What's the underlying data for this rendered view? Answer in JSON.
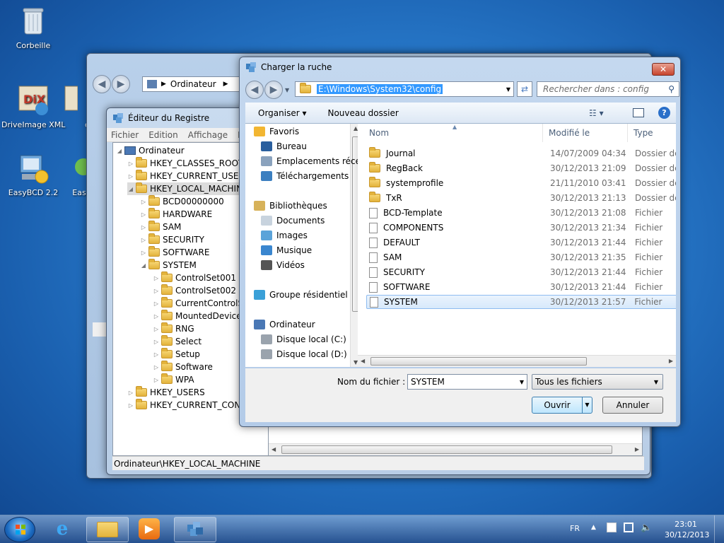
{
  "desktop": {
    "icons": [
      {
        "label": "Corbeille"
      },
      {
        "label": "DriveImage XML"
      },
      {
        "label": "di"
      },
      {
        "label": "EasyBCD 2.2"
      },
      {
        "label": "Eas"
      }
    ]
  },
  "explorer_back": {
    "address": "Ordinateur"
  },
  "regedit": {
    "title": "Éditeur du Registre",
    "menu": [
      "Fichier",
      "Edition",
      "Affichage",
      "Fa"
    ],
    "tree": [
      {
        "label": "Ordinateur",
        "level": 0,
        "expanded": true
      },
      {
        "label": "HKEY_CLASSES_ROOT",
        "level": 1
      },
      {
        "label": "HKEY_CURRENT_USER",
        "level": 1
      },
      {
        "label": "HKEY_LOCAL_MACHINE",
        "level": 1,
        "expanded": true,
        "selected": true
      },
      {
        "label": "BCD00000000",
        "level": 2
      },
      {
        "label": "HARDWARE",
        "level": 2
      },
      {
        "label": "SAM",
        "level": 2
      },
      {
        "label": "SECURITY",
        "level": 2
      },
      {
        "label": "SOFTWARE",
        "level": 2
      },
      {
        "label": "SYSTEM",
        "level": 2,
        "expanded": true
      },
      {
        "label": "ControlSet001",
        "level": 3
      },
      {
        "label": "ControlSet002",
        "level": 3
      },
      {
        "label": "CurrentControlSet",
        "level": 3
      },
      {
        "label": "MountedDevices",
        "level": 3
      },
      {
        "label": "RNG",
        "level": 3
      },
      {
        "label": "Select",
        "level": 3
      },
      {
        "label": "Setup",
        "level": 3
      },
      {
        "label": "Software",
        "level": 3
      },
      {
        "label": "WPA",
        "level": 3
      },
      {
        "label": "HKEY_USERS",
        "level": 1
      },
      {
        "label": "HKEY_CURRENT_CONFIG",
        "level": 1
      }
    ],
    "status": "Ordinateur\\HKEY_LOCAL_MACHINE"
  },
  "dialog": {
    "title": "Charger la ruche",
    "close_label": "✕",
    "address": "E:\\Windows\\System32\\config",
    "search_placeholder": "Rechercher dans : config",
    "toolbar": {
      "organize": "Organiser ▾",
      "new_folder": "Nouveau dossier"
    },
    "nav": [
      {
        "label": "Favoris",
        "type": "header",
        "icon": "star-icon"
      },
      {
        "label": "Bureau",
        "icon": "desktop-icon"
      },
      {
        "label": "Emplacements récents",
        "icon": "recent-icon"
      },
      {
        "label": "Téléchargements",
        "icon": "downloads-icon"
      },
      {
        "label": "Bibliothèques",
        "type": "header",
        "icon": "library-icon"
      },
      {
        "label": "Documents",
        "icon": "documents-icon"
      },
      {
        "label": "Images",
        "icon": "images-icon"
      },
      {
        "label": "Musique",
        "icon": "music-icon"
      },
      {
        "label": "Vidéos",
        "icon": "videos-icon"
      },
      {
        "label": "Groupe résidentiel",
        "type": "header",
        "icon": "homegroup-icon"
      },
      {
        "label": "Ordinateur",
        "type": "header",
        "icon": "computer-icon"
      },
      {
        "label": "Disque local (C:)",
        "icon": "drive-icon"
      },
      {
        "label": "Disque local (D:)",
        "icon": "drive-icon"
      }
    ],
    "columns": {
      "name": "Nom",
      "modified": "Modifié le",
      "type": "Type"
    },
    "files": [
      {
        "name": "Journal",
        "date": "14/07/2009 04:34",
        "type": "Dossier de",
        "kind": "folder"
      },
      {
        "name": "RegBack",
        "date": "30/12/2013 21:09",
        "type": "Dossier de",
        "kind": "folder"
      },
      {
        "name": "systemprofile",
        "date": "21/11/2010 03:41",
        "type": "Dossier de",
        "kind": "folder"
      },
      {
        "name": "TxR",
        "date": "30/12/2013 21:13",
        "type": "Dossier de",
        "kind": "folder"
      },
      {
        "name": "BCD-Template",
        "date": "30/12/2013 21:08",
        "type": "Fichier",
        "kind": "file"
      },
      {
        "name": "COMPONENTS",
        "date": "30/12/2013 21:34",
        "type": "Fichier",
        "kind": "file"
      },
      {
        "name": "DEFAULT",
        "date": "30/12/2013 21:44",
        "type": "Fichier",
        "kind": "file"
      },
      {
        "name": "SAM",
        "date": "30/12/2013 21:35",
        "type": "Fichier",
        "kind": "file"
      },
      {
        "name": "SECURITY",
        "date": "30/12/2013 21:44",
        "type": "Fichier",
        "kind": "file"
      },
      {
        "name": "SOFTWARE",
        "date": "30/12/2013 21:44",
        "type": "Fichier",
        "kind": "file"
      },
      {
        "name": "SYSTEM",
        "date": "30/12/2013 21:57",
        "type": "Fichier",
        "kind": "file",
        "selected": true
      }
    ],
    "filename_label": "Nom du fichier :",
    "filename_value": "SYSTEM",
    "filetype_value": "Tous les fichiers",
    "open_label": "Ouvrir",
    "cancel_label": "Annuler"
  },
  "taskbar": {
    "lang": "FR",
    "time": "23:01",
    "date": "30/12/2013"
  }
}
